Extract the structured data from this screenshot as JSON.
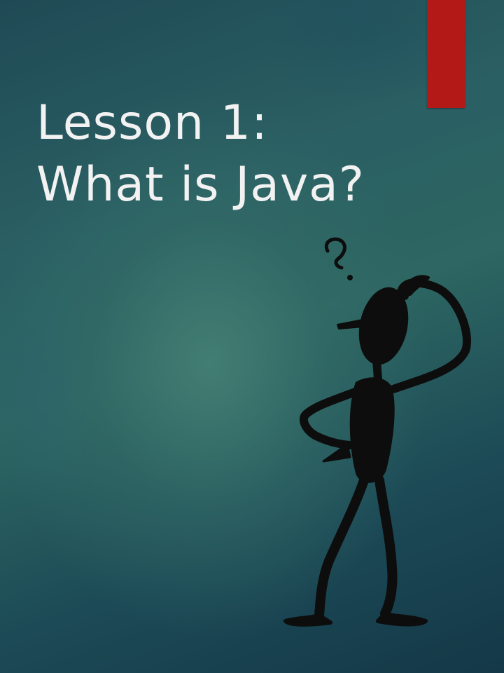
{
  "slide": {
    "title_line1": "Lesson 1:",
    "title_line2": "What is Java?"
  },
  "colors": {
    "accent_bar": "#b31a17",
    "title_text": "#f2f2f2",
    "figure": "#0d0d0d"
  },
  "illustration": {
    "icon": "confused-stick-figure-icon"
  }
}
